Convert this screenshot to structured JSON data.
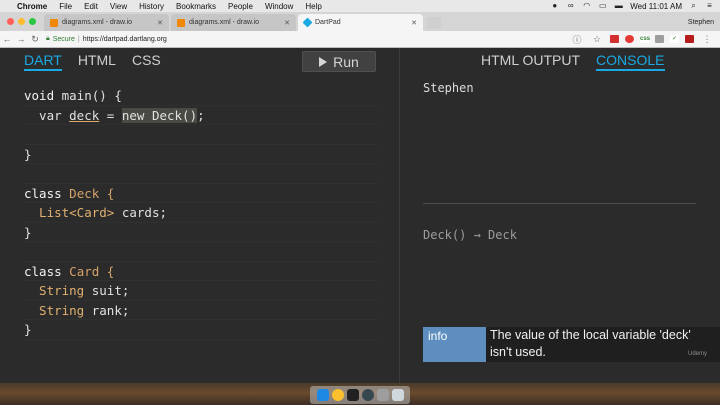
{
  "menubar": {
    "app_name": "Chrome",
    "items": [
      "File",
      "Edit",
      "View",
      "History",
      "Bookmarks",
      "People",
      "Window",
      "Help"
    ],
    "clock": "Wed 11:01 AM"
  },
  "browser": {
    "tabs": [
      {
        "title": "diagrams.xml - draw.io",
        "favicon_color": "#f08705"
      },
      {
        "title": "diagrams.xml - draw.io",
        "favicon_color": "#f08705"
      },
      {
        "title": "DartPad",
        "favicon_color": "#1ba9e3"
      }
    ],
    "user": "Stephen",
    "secure_label": "Secure",
    "url": "https://dartpad.dartlang.org"
  },
  "editor": {
    "tabs": [
      "DART",
      "HTML",
      "CSS"
    ],
    "run_label": "Run",
    "code": {
      "l1a": "void",
      "l1b": " main() {",
      "l2a": "  var ",
      "l2b": "deck",
      "l2c": " = ",
      "l2d": "new Deck()",
      "l2e": ";",
      "l4": "}",
      "l6a": "class",
      "l6b": " Deck {",
      "l7a": "  List<Card>",
      "l7b": " cards;",
      "l8": "}",
      "l10a": "class",
      "l10b": " Card {",
      "l11a": "  String",
      "l11b": " suit;",
      "l12a": "  String",
      "l12b": " rank;",
      "l13": "}"
    }
  },
  "output": {
    "tabs": [
      "HTML OUTPUT",
      "CONSOLE"
    ],
    "console_text": "Stephen",
    "doc_text": "Deck() → Deck"
  },
  "issue": {
    "tag": "info",
    "message": "The value of the local variable 'deck' isn't used."
  },
  "watermark": "Udemy",
  "colors": {
    "accent": "#1ba9e3",
    "info": "#5d8ebf"
  }
}
